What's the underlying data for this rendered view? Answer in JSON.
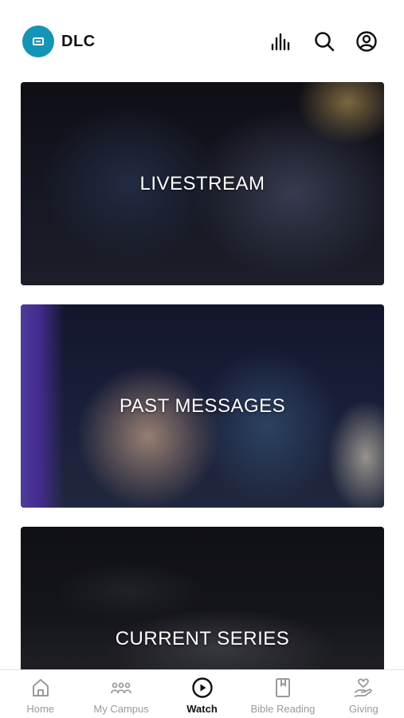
{
  "header": {
    "brand": "DLC",
    "icons": [
      "audio-bars-icon",
      "search-icon",
      "account-icon"
    ]
  },
  "cards": [
    {
      "title": "LIVESTREAM"
    },
    {
      "title": "PAST MESSAGES"
    },
    {
      "title": "CURRENT SERIES"
    }
  ],
  "tabbar": {
    "tabs": [
      {
        "label": "Home",
        "icon": "home-icon",
        "active": false
      },
      {
        "label": "My Campus",
        "icon": "campus-icon",
        "active": false
      },
      {
        "label": "Watch",
        "icon": "play-icon",
        "active": true
      },
      {
        "label": "Bible Reading",
        "icon": "book-icon",
        "active": false
      },
      {
        "label": "Giving",
        "icon": "giving-icon",
        "active": false
      }
    ]
  },
  "colors": {
    "brand": "#1594b6",
    "active_tab": "#111111",
    "inactive_tab": "#9a9a9a"
  }
}
